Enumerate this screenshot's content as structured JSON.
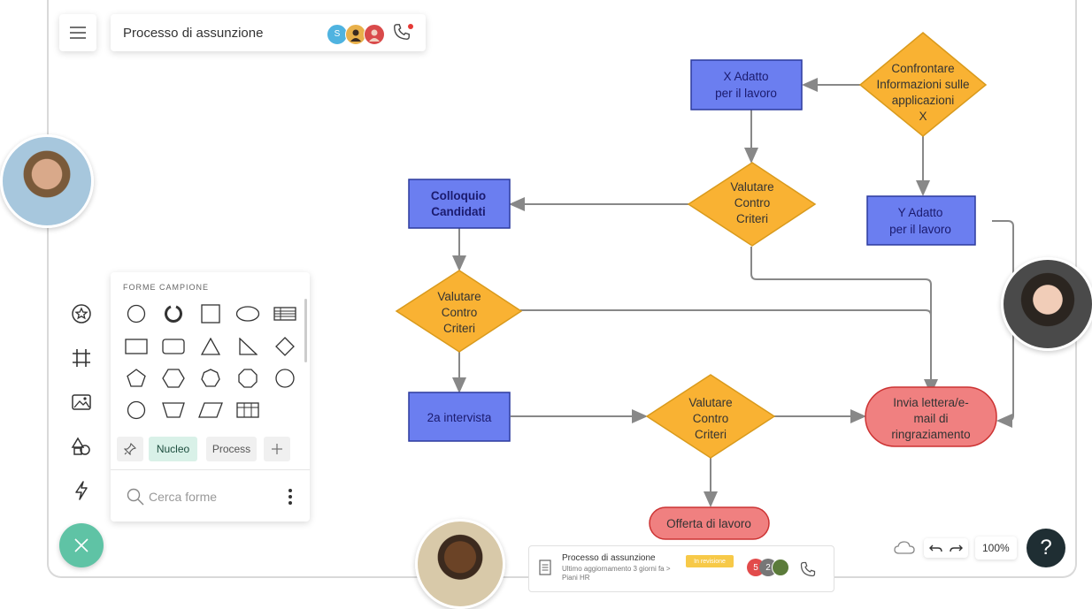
{
  "header": {
    "doc_title": "Processo di assunzione",
    "collaborator_initial": "S"
  },
  "shapes_panel": {
    "header": "FORME CAMPIONE",
    "tabs": [
      "Nucleo",
      "Process"
    ],
    "search_placeholder": "Cerca forme"
  },
  "flowchart": {
    "compare": [
      "Confrontare",
      "Informazioni sulle",
      "applicazioni",
      "X"
    ],
    "x_fit": [
      "X Adatto",
      "per il lavoro"
    ],
    "evaluate_top": [
      "Valutare",
      "Contro",
      "Criteri"
    ],
    "y_fit": [
      "Y Adatto",
      "per il lavoro"
    ],
    "interview_candidates": [
      "Colloquio",
      "Candidati"
    ],
    "evaluate_mid": [
      "Valutare",
      "Contro",
      "Criteri"
    ],
    "second_interview": "2a intervista",
    "evaluate_bottom": [
      "Valutare",
      "Contro",
      "Criteri"
    ],
    "thank_you": [
      "Invia lettera/e-",
      "mail di",
      "ringraziamento"
    ],
    "job_offer": "Offerta di lavoro"
  },
  "bottom_card": {
    "title": "Processo di assunzione",
    "subtitle": "Ultimo aggiornamento 3 giorni fa > Piani HR",
    "badge": "In revisione",
    "count_a": "5",
    "count_b": "2"
  },
  "zoom": {
    "level": "100%"
  },
  "help": {
    "label": "?"
  },
  "colors": {
    "blue_node": "#6b7ef0",
    "orange_node": "#f9b233",
    "red_node": "#f08080",
    "accent_green": "#5fc3a5"
  }
}
